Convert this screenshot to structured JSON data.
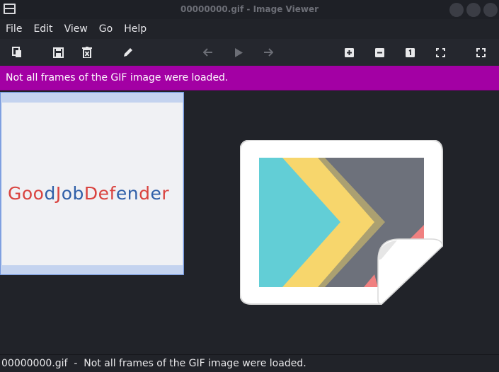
{
  "window": {
    "title": "00000000.gif - Image Viewer"
  },
  "menu": {
    "items": [
      "File",
      "Edit",
      "View",
      "Go",
      "Help"
    ]
  },
  "toolbar": {
    "icons": [
      "copy-icon",
      "save-icon",
      "delete-icon",
      "edit-icon",
      "back-arrow-icon",
      "play-icon",
      "forward-arrow-icon",
      "zoom-in-icon",
      "zoom-out-icon",
      "zoom-original-icon",
      "fit-icon",
      "fullscreen-icon"
    ]
  },
  "infobar": {
    "message": "Not all frames of the GIF image were loaded."
  },
  "thumbnail": {
    "logo_parts": [
      "G",
      "oo",
      "d",
      "J",
      "o",
      "b",
      "D",
      "e",
      "f",
      "e",
      "n",
      "d",
      "e",
      "r"
    ]
  },
  "statusbar": {
    "text": "00000000.gif  -  Not all frames of the GIF image were loaded."
  },
  "colors": {
    "infobar_bg": "#a300a4",
    "accent_border": "#6e93dc"
  }
}
